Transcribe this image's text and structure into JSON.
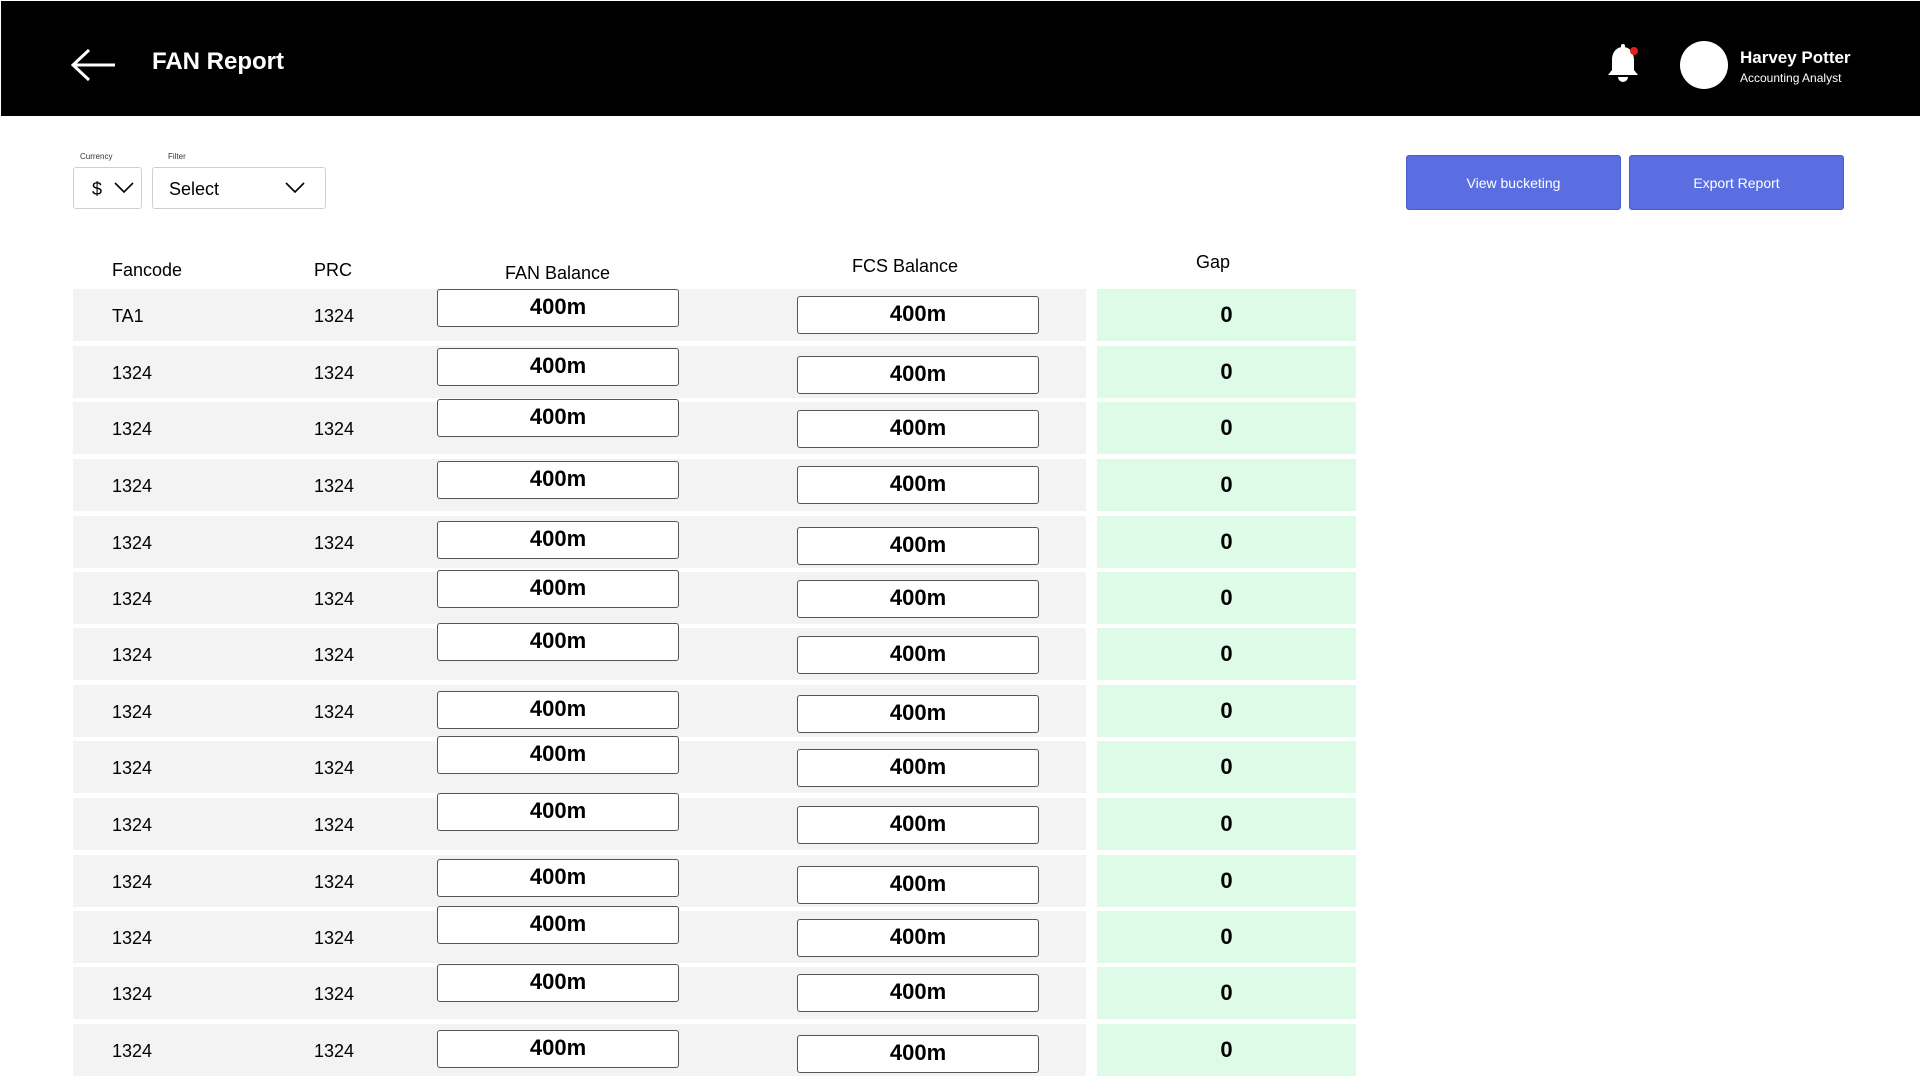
{
  "header": {
    "back_icon": "arrow-left-icon",
    "title": "FAN Report",
    "notification_icon": "bell-icon",
    "user": {
      "name": "Harvey Potter",
      "role": "Accounting Analyst"
    }
  },
  "controls": {
    "currency": {
      "label": "Currency",
      "value": "$"
    },
    "filter": {
      "label": "Filter",
      "value": "Select"
    },
    "view_bucketing_label": "View bucketing",
    "export_report_label": "Export Report"
  },
  "table": {
    "columns": [
      "Fancode",
      "PRC",
      "FAN Balance",
      "FCS Balance",
      "Gap"
    ],
    "rows": [
      {
        "fancode": "TA1",
        "prc": "1324",
        "fan_balance": "400m",
        "fcs_balance": "400m",
        "gap": "0"
      },
      {
        "fancode": "1324",
        "prc": "1324",
        "fan_balance": "400m",
        "fcs_balance": "400m",
        "gap": "0"
      },
      {
        "fancode": "1324",
        "prc": "1324",
        "fan_balance": "400m",
        "fcs_balance": "400m",
        "gap": "0"
      },
      {
        "fancode": "1324",
        "prc": "1324",
        "fan_balance": "400m",
        "fcs_balance": "400m",
        "gap": "0"
      },
      {
        "fancode": "1324",
        "prc": "1324",
        "fan_balance": "400m",
        "fcs_balance": "400m",
        "gap": "0"
      },
      {
        "fancode": "1324",
        "prc": "1324",
        "fan_balance": "400m",
        "fcs_balance": "400m",
        "gap": "0"
      },
      {
        "fancode": "1324",
        "prc": "1324",
        "fan_balance": "400m",
        "fcs_balance": "400m",
        "gap": "0"
      },
      {
        "fancode": "1324",
        "prc": "1324",
        "fan_balance": "400m",
        "fcs_balance": "400m",
        "gap": "0"
      },
      {
        "fancode": "1324",
        "prc": "1324",
        "fan_balance": "400m",
        "fcs_balance": "400m",
        "gap": "0"
      },
      {
        "fancode": "1324",
        "prc": "1324",
        "fan_balance": "400m",
        "fcs_balance": "400m",
        "gap": "0"
      },
      {
        "fancode": "1324",
        "prc": "1324",
        "fan_balance": "400m",
        "fcs_balance": "400m",
        "gap": "0"
      },
      {
        "fancode": "1324",
        "prc": "1324",
        "fan_balance": "400m",
        "fcs_balance": "400m",
        "gap": "0"
      },
      {
        "fancode": "1324",
        "prc": "1324",
        "fan_balance": "400m",
        "fcs_balance": "400m",
        "gap": "0"
      },
      {
        "fancode": "1324",
        "prc": "1324",
        "fan_balance": "400m",
        "fcs_balance": "400m",
        "gap": "0"
      }
    ]
  },
  "colors": {
    "header_bg": "#000000",
    "button_bg": "#5b6ee1",
    "row_bg": "#f3f3f3",
    "gap_bg": "#ddfbe6",
    "notification_dot": "#e02020"
  }
}
